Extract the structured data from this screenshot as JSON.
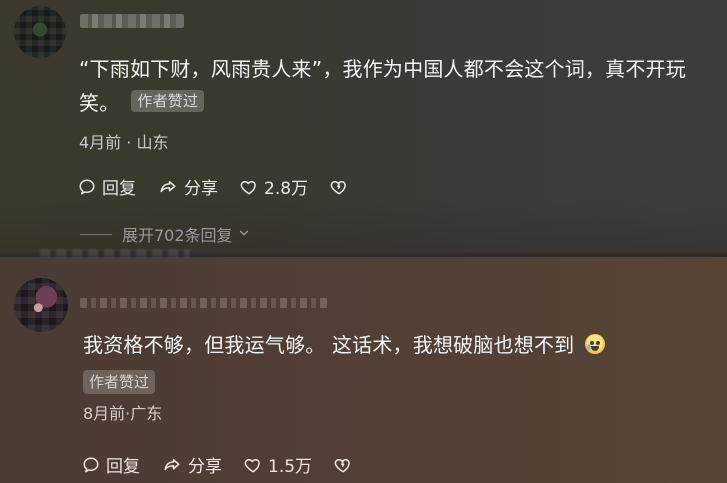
{
  "comments": [
    {
      "text": "“下雨如下财，风雨贵人来”，我作为中国人都不会这个词，真不开玩笑。",
      "badge": "作者赞过",
      "meta": "4月前 · 山东",
      "actions": {
        "reply": "回复",
        "share": "分享",
        "likes": "2.8万"
      },
      "expand_replies": "展开702条回复"
    },
    {
      "text": "我资格不够，但我运气够。 这话术，我想破脑也想不到",
      "badge": "作者赞过",
      "meta": "8月前·广东",
      "actions": {
        "reply": "回复",
        "share": "分享",
        "likes": "1.5万"
      }
    }
  ],
  "icons": {
    "reply": "speech-bubble-icon",
    "share": "share-arrow-icon",
    "like": "heart-outline-icon",
    "dislike": "broken-heart-icon",
    "expand": "chevron-down-icon",
    "emoji": "crying-face-emoji"
  }
}
